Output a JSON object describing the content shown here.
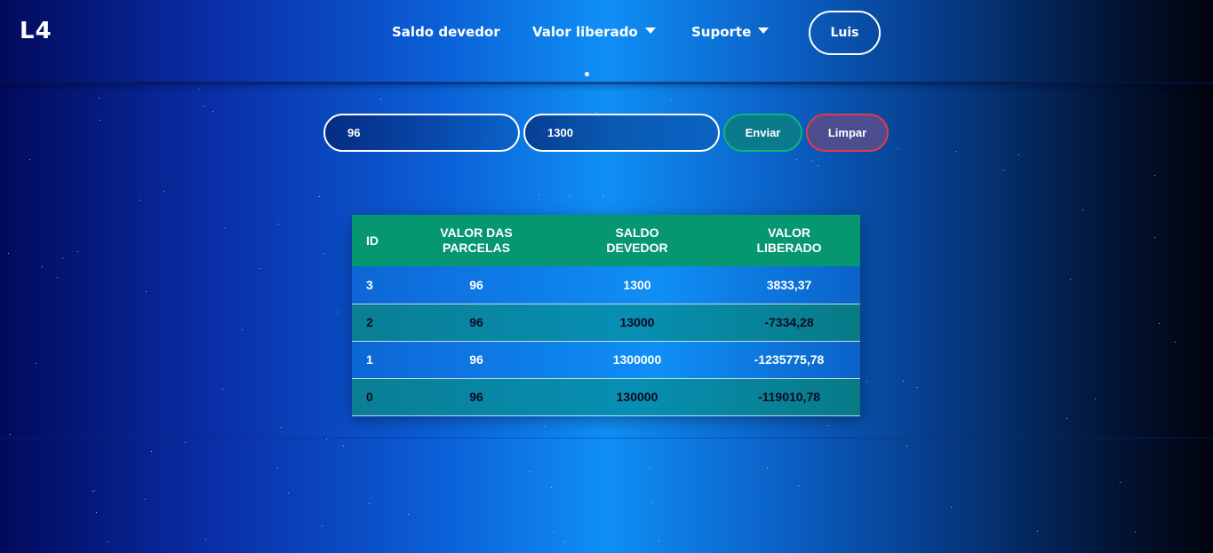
{
  "brand": {
    "logo": "L4"
  },
  "nav": {
    "items": [
      {
        "label": "Saldo devedor",
        "has_caret": false
      },
      {
        "label": "Valor liberado",
        "has_caret": true
      },
      {
        "label": "Suporte",
        "has_caret": true
      }
    ],
    "user_label": "Luis"
  },
  "form": {
    "field1_value": "96",
    "field2_value": "1300",
    "send_label": "Enviar",
    "clear_label": "Limpar"
  },
  "table": {
    "headers": [
      "ID",
      "VALOR DAS PARCELAS",
      "SALDO DEVEDOR",
      "VALOR LIBERADO"
    ],
    "rows": [
      [
        "3",
        "96",
        "1300",
        "3833,37"
      ],
      [
        "2",
        "96",
        "13000",
        "-7334,28"
      ],
      [
        "1",
        "96",
        "1300000",
        "-1235775,78"
      ],
      [
        "0",
        "96",
        "130000",
        "-119010,78"
      ]
    ]
  },
  "colors": {
    "header_row": "#069670",
    "send_border": "#0bb77a",
    "clear_border": "#e23b4a"
  }
}
